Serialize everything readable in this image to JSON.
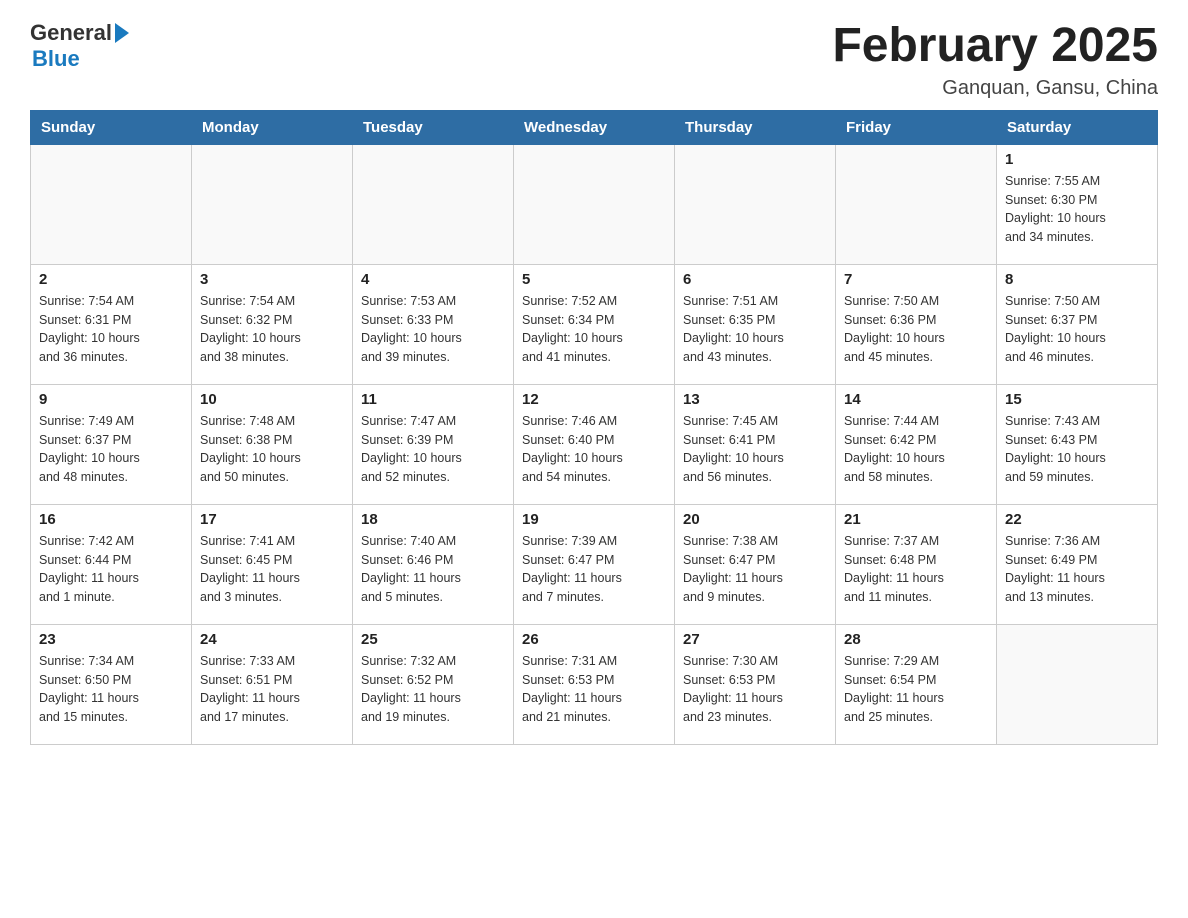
{
  "logo": {
    "general": "General",
    "blue": "Blue"
  },
  "title": "February 2025",
  "location": "Ganquan, Gansu, China",
  "weekdays": [
    "Sunday",
    "Monday",
    "Tuesday",
    "Wednesday",
    "Thursday",
    "Friday",
    "Saturday"
  ],
  "weeks": [
    [
      {
        "day": "",
        "info": ""
      },
      {
        "day": "",
        "info": ""
      },
      {
        "day": "",
        "info": ""
      },
      {
        "day": "",
        "info": ""
      },
      {
        "day": "",
        "info": ""
      },
      {
        "day": "",
        "info": ""
      },
      {
        "day": "1",
        "info": "Sunrise: 7:55 AM\nSunset: 6:30 PM\nDaylight: 10 hours\nand 34 minutes."
      }
    ],
    [
      {
        "day": "2",
        "info": "Sunrise: 7:54 AM\nSunset: 6:31 PM\nDaylight: 10 hours\nand 36 minutes."
      },
      {
        "day": "3",
        "info": "Sunrise: 7:54 AM\nSunset: 6:32 PM\nDaylight: 10 hours\nand 38 minutes."
      },
      {
        "day": "4",
        "info": "Sunrise: 7:53 AM\nSunset: 6:33 PM\nDaylight: 10 hours\nand 39 minutes."
      },
      {
        "day": "5",
        "info": "Sunrise: 7:52 AM\nSunset: 6:34 PM\nDaylight: 10 hours\nand 41 minutes."
      },
      {
        "day": "6",
        "info": "Sunrise: 7:51 AM\nSunset: 6:35 PM\nDaylight: 10 hours\nand 43 minutes."
      },
      {
        "day": "7",
        "info": "Sunrise: 7:50 AM\nSunset: 6:36 PM\nDaylight: 10 hours\nand 45 minutes."
      },
      {
        "day": "8",
        "info": "Sunrise: 7:50 AM\nSunset: 6:37 PM\nDaylight: 10 hours\nand 46 minutes."
      }
    ],
    [
      {
        "day": "9",
        "info": "Sunrise: 7:49 AM\nSunset: 6:37 PM\nDaylight: 10 hours\nand 48 minutes."
      },
      {
        "day": "10",
        "info": "Sunrise: 7:48 AM\nSunset: 6:38 PM\nDaylight: 10 hours\nand 50 minutes."
      },
      {
        "day": "11",
        "info": "Sunrise: 7:47 AM\nSunset: 6:39 PM\nDaylight: 10 hours\nand 52 minutes."
      },
      {
        "day": "12",
        "info": "Sunrise: 7:46 AM\nSunset: 6:40 PM\nDaylight: 10 hours\nand 54 minutes."
      },
      {
        "day": "13",
        "info": "Sunrise: 7:45 AM\nSunset: 6:41 PM\nDaylight: 10 hours\nand 56 minutes."
      },
      {
        "day": "14",
        "info": "Sunrise: 7:44 AM\nSunset: 6:42 PM\nDaylight: 10 hours\nand 58 minutes."
      },
      {
        "day": "15",
        "info": "Sunrise: 7:43 AM\nSunset: 6:43 PM\nDaylight: 10 hours\nand 59 minutes."
      }
    ],
    [
      {
        "day": "16",
        "info": "Sunrise: 7:42 AM\nSunset: 6:44 PM\nDaylight: 11 hours\nand 1 minute."
      },
      {
        "day": "17",
        "info": "Sunrise: 7:41 AM\nSunset: 6:45 PM\nDaylight: 11 hours\nand 3 minutes."
      },
      {
        "day": "18",
        "info": "Sunrise: 7:40 AM\nSunset: 6:46 PM\nDaylight: 11 hours\nand 5 minutes."
      },
      {
        "day": "19",
        "info": "Sunrise: 7:39 AM\nSunset: 6:47 PM\nDaylight: 11 hours\nand 7 minutes."
      },
      {
        "day": "20",
        "info": "Sunrise: 7:38 AM\nSunset: 6:47 PM\nDaylight: 11 hours\nand 9 minutes."
      },
      {
        "day": "21",
        "info": "Sunrise: 7:37 AM\nSunset: 6:48 PM\nDaylight: 11 hours\nand 11 minutes."
      },
      {
        "day": "22",
        "info": "Sunrise: 7:36 AM\nSunset: 6:49 PM\nDaylight: 11 hours\nand 13 minutes."
      }
    ],
    [
      {
        "day": "23",
        "info": "Sunrise: 7:34 AM\nSunset: 6:50 PM\nDaylight: 11 hours\nand 15 minutes."
      },
      {
        "day": "24",
        "info": "Sunrise: 7:33 AM\nSunset: 6:51 PM\nDaylight: 11 hours\nand 17 minutes."
      },
      {
        "day": "25",
        "info": "Sunrise: 7:32 AM\nSunset: 6:52 PM\nDaylight: 11 hours\nand 19 minutes."
      },
      {
        "day": "26",
        "info": "Sunrise: 7:31 AM\nSunset: 6:53 PM\nDaylight: 11 hours\nand 21 minutes."
      },
      {
        "day": "27",
        "info": "Sunrise: 7:30 AM\nSunset: 6:53 PM\nDaylight: 11 hours\nand 23 minutes."
      },
      {
        "day": "28",
        "info": "Sunrise: 7:29 AM\nSunset: 6:54 PM\nDaylight: 11 hours\nand 25 minutes."
      },
      {
        "day": "",
        "info": ""
      }
    ]
  ]
}
